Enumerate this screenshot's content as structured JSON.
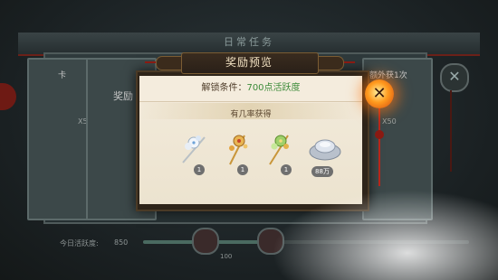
{
  "background": {
    "banner_title": "日常任务",
    "card_labels": [
      "卡",
      "奖励"
    ],
    "right_card_label": "额外获1次",
    "dim_counts": [
      "X50",
      "X50"
    ],
    "today_activity_label": "今日活跃度:",
    "today_activity_value": "850",
    "milestone": "100"
  },
  "modal": {
    "title": "奖励预览",
    "unlock_label": "解锁条件：",
    "unlock_value": "700点活跃度",
    "subtitle": "有几率获得",
    "rewards": [
      {
        "icon": "white-flower-hairpin-icon",
        "count": "1"
      },
      {
        "icon": "gold-hairpin-icon",
        "count": "1"
      },
      {
        "icon": "green-gold-hairpin-icon",
        "count": "1"
      },
      {
        "icon": "silver-ingot-icon",
        "count": "88万"
      }
    ],
    "close_icon": "close-icon"
  },
  "colors": {
    "unlock_value": "#3c8b39",
    "title_bar": "#2a2018",
    "lantern": "#ff9a1e"
  }
}
